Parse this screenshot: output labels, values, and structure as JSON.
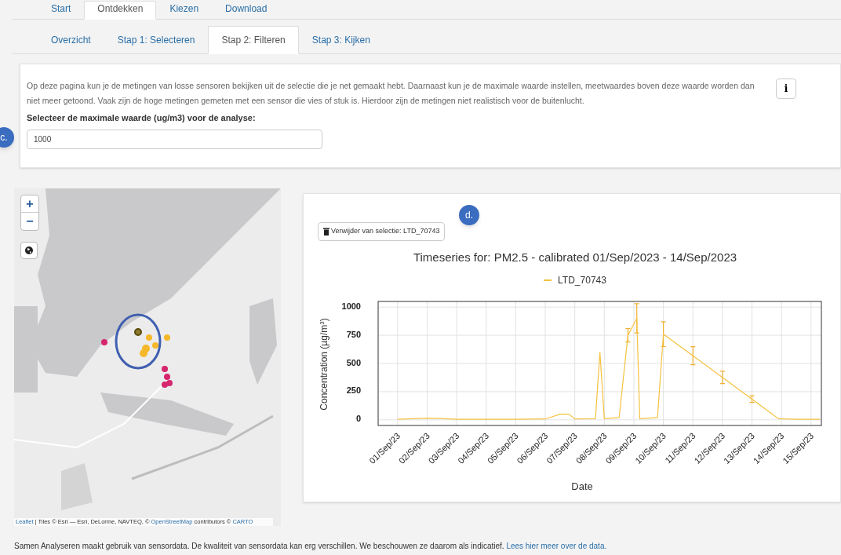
{
  "main_tabs": [
    {
      "label": "Start",
      "selected": false
    },
    {
      "label": "Ontdekken",
      "selected": true
    },
    {
      "label": "Kiezen",
      "selected": false
    },
    {
      "label": "Download",
      "selected": false
    }
  ],
  "sub_tabs": [
    {
      "label": "Overzicht",
      "selected": false
    },
    {
      "label": "Stap 1: Selecteren",
      "selected": false
    },
    {
      "label": "Stap 2: Filteren",
      "selected": true
    },
    {
      "label": "Stap 3: Kijken",
      "selected": false
    }
  ],
  "info_panel": {
    "description": "Op deze pagina kun je de metingen van losse sensoren bekijken uit de selectie die je net gemaakt hebt. Daarnaast kun je de maximale waarde instellen, meetwaardes boven deze waarde worden dan niet meer getoond. Vaak zijn de hoge metingen gemeten met een sensor die vies of stuk is. Hierdoor zijn de metingen niet realistisch voor de buitenlucht.",
    "info_button": "i",
    "field_label": "Selecteer de maximale waarde (ug/m3) voor de analyse:",
    "field_value": "1000",
    "callout": "c."
  },
  "map": {
    "zoom_in": "+",
    "zoom_out": "−",
    "attribution_link": "Leaflet",
    "attribution_text": " | Tiles © Esri — Esri, DeLorme, NAVTEQ, © ",
    "attribution_osm": "OpenStreetMap",
    "attribution_rest": " contributors © ",
    "attribution_carto": "CARTO"
  },
  "chart_panel": {
    "remove_button": "Verwijder van selectie: LTD_70743",
    "callout": "d.",
    "chart_data": {
      "type": "line",
      "title": "Timeseries for: PM2.5 - calibrated  01/Sep/2023 - 14/Sep/2023",
      "xlabel": "Date",
      "ylabel": "Concentration (µg/m$^{3}$)",
      "x": [
        "2023-09-01T00:00",
        "2023-09-01T12:00",
        "2023-09-02T00:00",
        "2023-09-02T12:00",
        "2023-09-03T00:00",
        "2023-09-04T00:00",
        "2023-09-05T00:00",
        "2023-09-06T00:00",
        "2023-09-06T12:00",
        "2023-09-06T19:12",
        "2023-09-07T00:00",
        "2023-09-07T16:48",
        "2023-09-07T20:24",
        "2023-09-08T00:00",
        "2023-09-08T12:00",
        "2023-09-08T19:12",
        "2023-09-09T02:24",
        "2023-09-09T04:48",
        "2023-09-09T19:12",
        "2023-09-10T00:00",
        "2023-09-11T00:00",
        "2023-09-12T00:00",
        "2023-09-13T00:00",
        "2023-09-13T21:36",
        "2023-09-14T12:00",
        "2023-09-15T07:12"
      ],
      "series": [
        {
          "name": "LTD_70743",
          "color": "#f5c242",
          "values": [
            5,
            10,
            15,
            12,
            5,
            5,
            5,
            8,
            50,
            50,
            8,
            10,
            600,
            10,
            20,
            750,
            900,
            10,
            20,
            760,
            568,
            376,
            184,
            10,
            5,
            5
          ],
          "errors": [
            null,
            null,
            null,
            null,
            null,
            null,
            null,
            null,
            null,
            null,
            null,
            null,
            null,
            null,
            null,
            60,
            130,
            null,
            null,
            110,
            80,
            55,
            30,
            null,
            null,
            null
          ]
        }
      ],
      "grid": true,
      "xlim": [
        "2023-08-31T08:10",
        "2023-09-15T08:24"
      ],
      "ylim": [
        -50,
        1050
      ],
      "xticks": [
        {
          "value": "2023-09-01T00:00",
          "label": "01/Sep/23"
        },
        {
          "value": "2023-09-02T00:00",
          "label": "02/Sep/23"
        },
        {
          "value": "2023-09-03T00:00",
          "label": "03/Sep/23"
        },
        {
          "value": "2023-09-04T00:00",
          "label": "04/Sep/23"
        },
        {
          "value": "2023-09-05T00:00",
          "label": "05/Sep/23"
        },
        {
          "value": "2023-09-06T00:00",
          "label": "06/Sep/23"
        },
        {
          "value": "2023-09-07T00:00",
          "label": "07/Sep/23"
        },
        {
          "value": "2023-09-08T00:00",
          "label": "08/Sep/23"
        },
        {
          "value": "2023-09-09T00:00",
          "label": "09/Sep/23"
        },
        {
          "value": "2023-09-10T00:00",
          "label": "10/Sep/23"
        },
        {
          "value": "2023-09-11T00:00",
          "label": "11/Sep/23"
        },
        {
          "value": "2023-09-12T00:00",
          "label": "12/Sep/23"
        },
        {
          "value": "2023-09-13T00:00",
          "label": "13/Sep/23"
        },
        {
          "value": "2023-09-14T00:00",
          "label": "14/Sep/23"
        },
        {
          "value": "2023-09-15T00:00",
          "label": "15/Sep/23"
        }
      ],
      "yticks": [
        0,
        250,
        500,
        750,
        1000
      ]
    }
  },
  "footer": {
    "text": "Samen Analyseren maakt gebruik van sensordata. De kwaliteit van sensordata kan erg verschillen. We beschouwen ze daarom als indicatief. ",
    "link": "Lees hier meer over de data."
  }
}
